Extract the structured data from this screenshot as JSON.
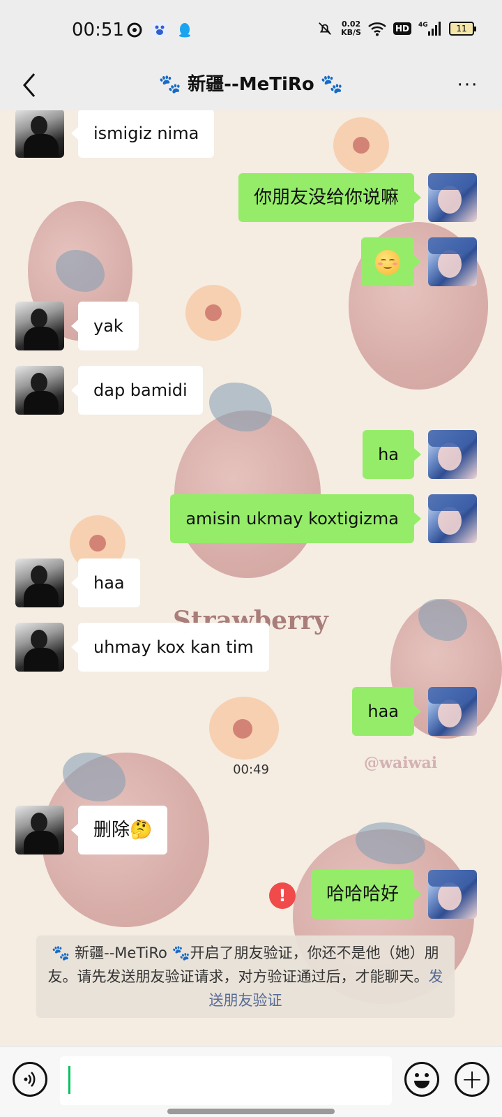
{
  "status_bar": {
    "time": "00:51",
    "net_speed_value": "0.02",
    "net_speed_unit": "KB/S",
    "hd_label": "HD",
    "network_label": "4G",
    "battery_level": "11",
    "icons": [
      "netease-music-icon",
      "baidu-icon",
      "qq-icon",
      "mute-icon",
      "wifi-icon",
      "signal-icon",
      "battery-icon"
    ]
  },
  "nav": {
    "title": "🐾 新疆--MeTiRo 🐾",
    "back_icon": "chevron-left-icon",
    "more_label": "···"
  },
  "chat": {
    "background_text": "Strawberry",
    "watermark": "@waiwai",
    "messages": [
      {
        "side": "them",
        "text": "ismigiz nima"
      },
      {
        "side": "me",
        "text": "你朋友没给你说嘛"
      },
      {
        "side": "me",
        "text": "",
        "emoji": "smiling-face-icon"
      },
      {
        "side": "them",
        "text": "yak"
      },
      {
        "side": "them",
        "text": "dap bamidi"
      },
      {
        "side": "me",
        "text": "ha"
      },
      {
        "side": "me",
        "text": "amisin ukmay koxtigizma"
      },
      {
        "side": "them",
        "text": "haa"
      },
      {
        "side": "them",
        "text": "uhmay kox kan tim"
      },
      {
        "side": "me",
        "text": "haa"
      },
      {
        "side": "them",
        "text": "删除🤔"
      },
      {
        "side": "me",
        "text": "哈哈哈好",
        "failed": true
      }
    ],
    "timestamp": "00:49",
    "error_mark": "!",
    "system_notice": "🐾 新疆--MeTiRo 🐾开启了朋友验证，你还不是他（她）朋友。请先发送朋友验证请求，对方验证通过后，才能聊天。",
    "system_notice_link": "发送朋友验证"
  },
  "input_bar": {
    "voice_icon": "voice-icon",
    "input_value": "",
    "emoji_icon": "emoji-icon",
    "plus_label": "+"
  }
}
